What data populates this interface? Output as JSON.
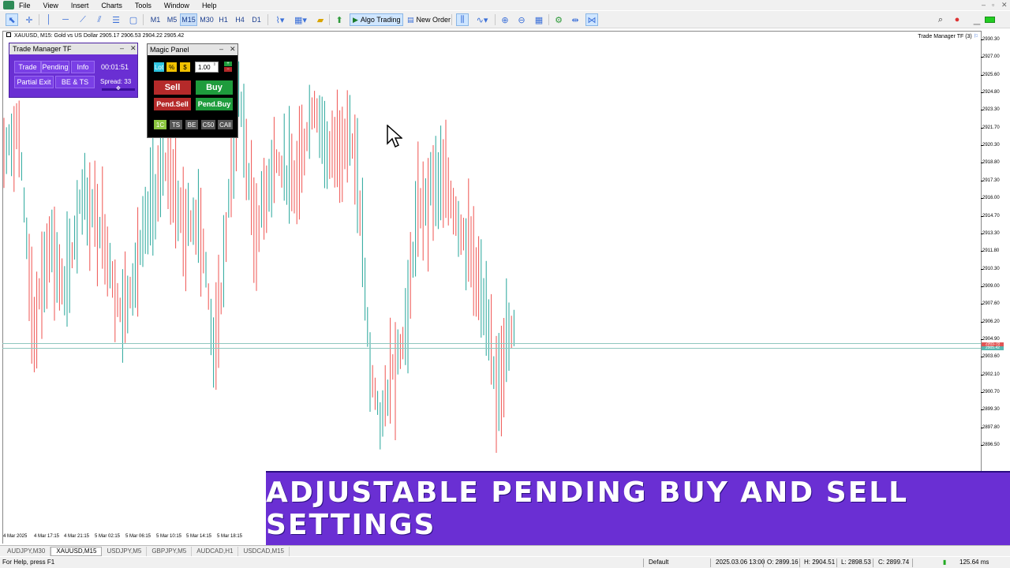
{
  "menu": {
    "items": [
      "File",
      "View",
      "Insert",
      "Charts",
      "Tools",
      "Window",
      "Help"
    ]
  },
  "toolbar": {
    "timeframes": [
      "M1",
      "M5",
      "M15",
      "M30",
      "H1",
      "H4",
      "D1"
    ],
    "active_timeframe": "M15",
    "algo_trading_label": "Algo Trading",
    "new_order_label": "New Order"
  },
  "chart": {
    "symbol_info": "XAUUSD, M15:  Gold vs US Dollar  2905.17 2906.53 2904.22 2905.42",
    "ea_label": "Trade Manager TF (3)",
    "price_ticks": [
      "2930.30",
      "2927.00",
      "2925.60",
      "2924.80",
      "2923.30",
      "2921.70",
      "2920.30",
      "2918.80",
      "2917.30",
      "2916.00",
      "2914.70",
      "2913.30",
      "2911.80",
      "2910.30",
      "2909.00",
      "2907.60",
      "2906.20",
      "2904.90",
      "2903.60",
      "2902.10",
      "2900.70",
      "2899.30",
      "2897.80",
      "2896.50"
    ],
    "price_marker_1": "2905.78",
    "price_marker_2": "2905.42",
    "time_ticks": [
      "4 Mar 2025",
      "4 Mar 17:15",
      "4 Mar 21:15",
      "5 Mar 02:15",
      "5 Mar 06:15",
      "5 Mar 10:15",
      "5 Mar 14:15",
      "5 Mar 18:15"
    ]
  },
  "trade_manager": {
    "title": "Trade Manager TF",
    "buttons": {
      "trade": "Trade",
      "pending": "Pending",
      "info": "Info",
      "partial_exit": "Partial Exit",
      "be_ts": "BE & TS"
    },
    "timer": "00:01:51",
    "spread": "Spread: 33"
  },
  "magic_panel": {
    "title": "Magic Panel",
    "lot_label": "Lot",
    "pct_label": "%",
    "usd_label": "$",
    "lot_value": "1.00",
    "sell_label": "Sell",
    "buy_label": "Buy",
    "pend_sell_label": "Pend.Sell",
    "pend_buy_label": "Pend.Buy",
    "options": [
      "1C",
      "TS",
      "BE",
      "C50",
      "CAll"
    ]
  },
  "banner": {
    "text": "ADJUSTABLE PENDING BUY AND SELL SETTINGS"
  },
  "tabs": {
    "items": [
      "AUDJPY,M30",
      "XAUUSD,M15",
      "USDJPY,M5",
      "GBPJPY,M5",
      "AUDCAD,H1",
      "USDCAD,M15"
    ],
    "active_index": 1
  },
  "status": {
    "help": "For Help, press F1",
    "profile": "Default",
    "datetime": "2025.03.06 13:00",
    "open": "O: 2899.16",
    "high": "H: 2904.51",
    "low": "L: 2898.53",
    "close": "C: 2899.74",
    "speed": "125.64 ms"
  },
  "colors": {
    "bull": "#26a69a",
    "bear": "#ef5350",
    "panel": "#6a2fd3",
    "sell": "#b52a2a",
    "buy": "#1e9c3c"
  }
}
